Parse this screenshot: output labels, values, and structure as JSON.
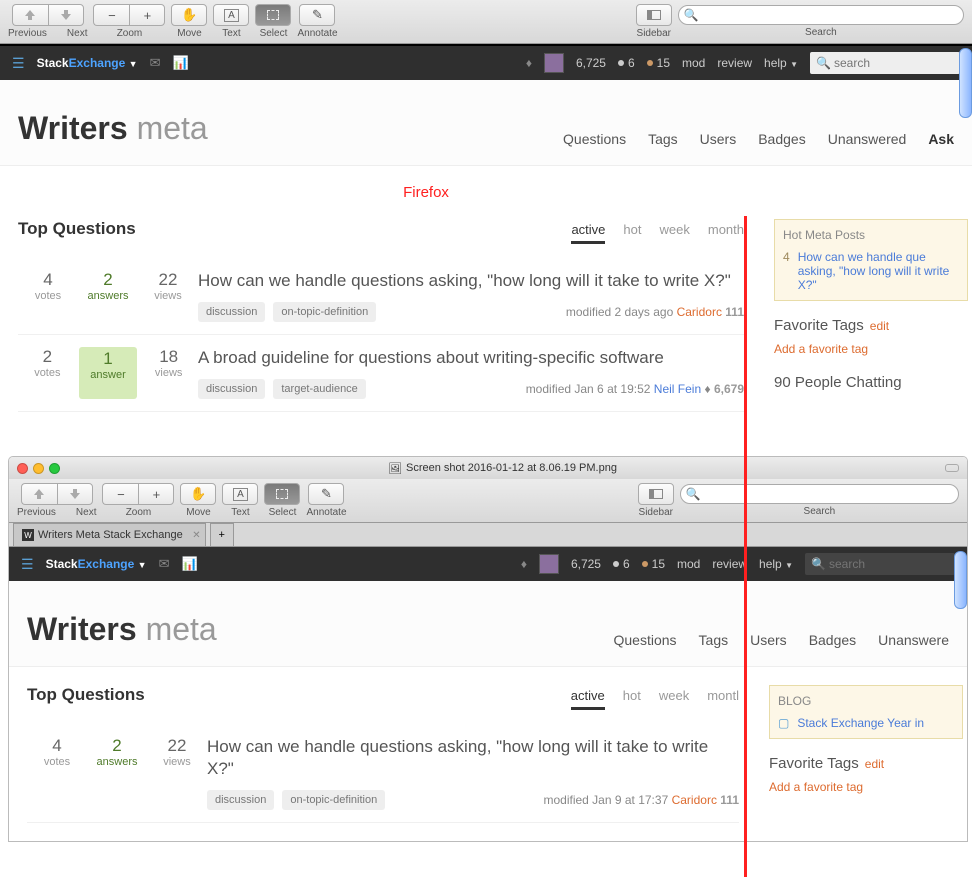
{
  "toolbar": {
    "prev": "Previous",
    "next": "Next",
    "zoom": "Zoom",
    "move": "Move",
    "text": "Text",
    "select": "Select",
    "annotate": "Annotate",
    "sidebar": "Sidebar",
    "search": "Search"
  },
  "topbar": {
    "brand1": "Stack",
    "brand2": "Exchange",
    "rep": "6,725",
    "silver": "6",
    "bronze": "15",
    "mod": "mod",
    "review": "review",
    "help": "help",
    "search_ph": "search"
  },
  "site": {
    "name": "Writers",
    "meta": "meta"
  },
  "nav": {
    "q": "Questions",
    "t": "Tags",
    "u": "Users",
    "b": "Badges",
    "un": "Unanswered",
    "ask": "Ask"
  },
  "nav2": {
    "q": "Questions",
    "t": "Tags",
    "u": "Users",
    "b": "Badges",
    "un": "Unanswere"
  },
  "section": "Top Questions",
  "annot": "Firefox",
  "tabs": {
    "active": "active",
    "hot": "hot",
    "week": "week",
    "month": "month"
  },
  "tabs2": {
    "active": "active",
    "hot": "hot",
    "week": "week",
    "month": "montl"
  },
  "q1": {
    "votes": "4",
    "vlbl": "votes",
    "ans": "2",
    "albl": "answers",
    "views": "22",
    "vwlbl": "views",
    "title": "How can we handle questions asking, \"how long will it take to write X?\"",
    "tag1": "discussion",
    "tag2": "on-topic-definition",
    "mod": "modified 2 days ago",
    "user": "Caridorc",
    "rep": "111"
  },
  "q2": {
    "votes": "2",
    "vlbl": "votes",
    "ans": "1",
    "albl": "answer",
    "views": "18",
    "vwlbl": "views",
    "title": "A broad guideline for questions about writing-specific software",
    "tag1": "discussion",
    "tag2": "target-audience",
    "mod": "modified Jan 6 at 19:52",
    "user": "Neil Fein",
    "rep": "6,679"
  },
  "q3": {
    "votes": "4",
    "vlbl": "votes",
    "ans": "2",
    "albl": "answers",
    "views": "22",
    "vwlbl": "views",
    "title": "How can we handle questions asking, \"how long will it take to write X?\"",
    "tag1": "discussion",
    "tag2": "on-topic-definition",
    "mod": "modified Jan 9 at 17:37",
    "user": "Caridorc",
    "rep": "111"
  },
  "hot": {
    "head": "Hot Meta Posts",
    "n": "4",
    "q": "How can we handle que asking, \"how long will it write X?\""
  },
  "fav": {
    "head": "Favorite Tags",
    "edit": "edit",
    "add": "Add a favorite tag"
  },
  "chat": "90 People Chatting",
  "blog": {
    "head": "BLOG",
    "link": "Stack Exchange Year in"
  },
  "win2": {
    "title": "Screen shot 2016-01-12 at 8.06.19 PM.png",
    "tab": "Writers Meta Stack Exchange"
  }
}
